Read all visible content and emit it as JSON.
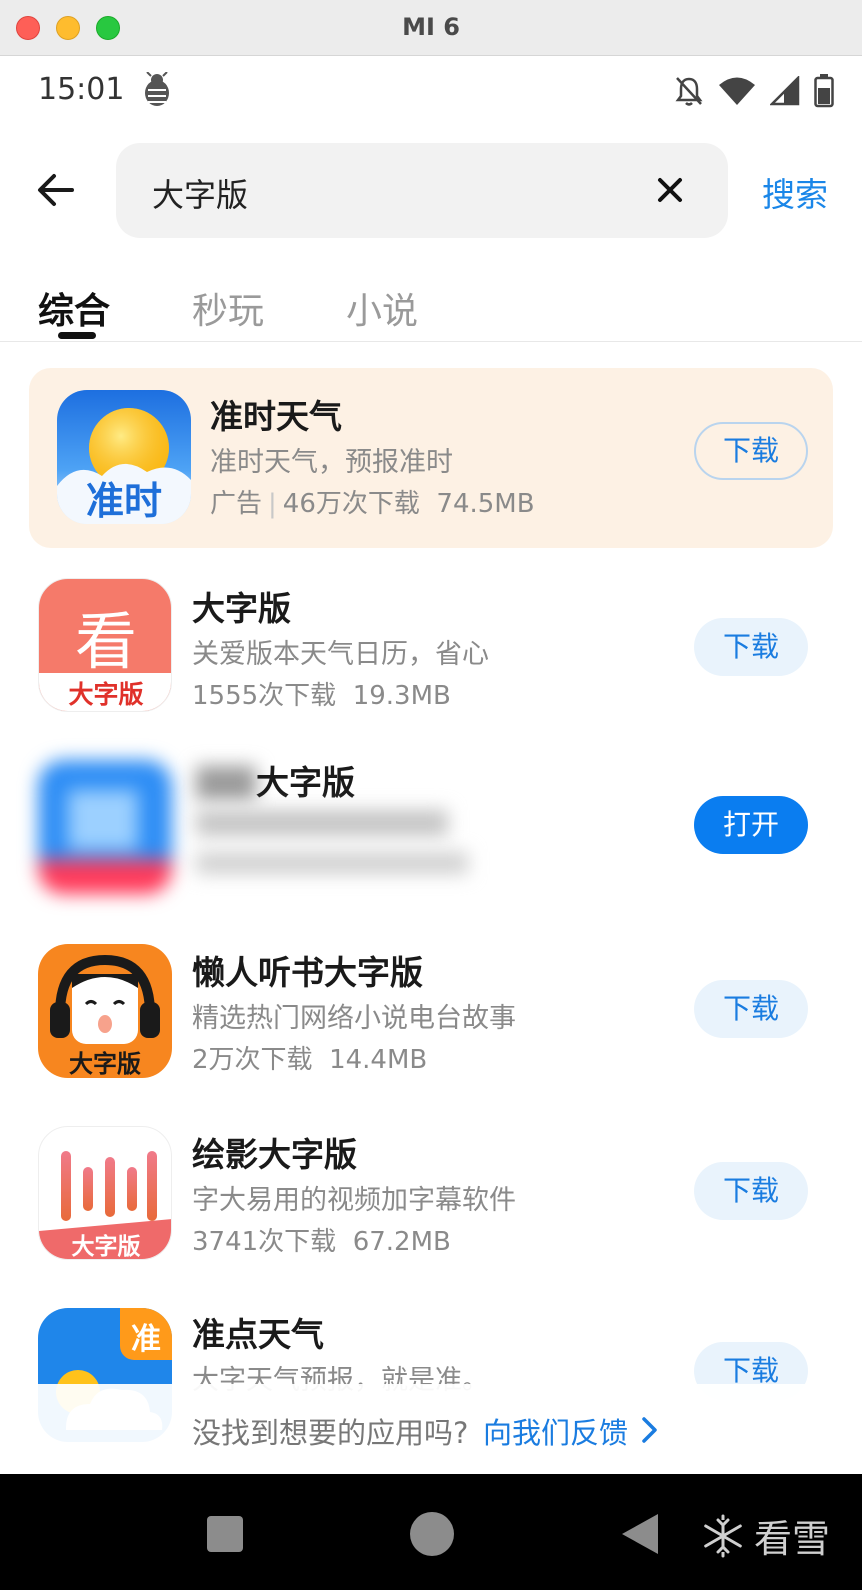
{
  "window": {
    "title": "MI 6"
  },
  "status_bar": {
    "time": "15:01",
    "icons": [
      "bug-icon",
      "bell-off-icon",
      "wifi-icon",
      "signal-icon",
      "battery-icon"
    ]
  },
  "search": {
    "query": "大字版",
    "button_label": "搜索"
  },
  "tabs": [
    {
      "label": "综合",
      "active": true
    },
    {
      "label": "秒玩",
      "active": false
    },
    {
      "label": "小说",
      "active": false
    }
  ],
  "apps": [
    {
      "name": "准时天气",
      "desc": "准时天气，预报准时",
      "ad_label": "广告",
      "downloads": "46万次下载",
      "size": "74.5MB",
      "button": "下载",
      "icon_text": "准时"
    },
    {
      "name": "大字版",
      "desc": "关爱版本天气日历，省心",
      "downloads": "1555次下载",
      "size": "19.3MB",
      "button": "下载",
      "icon_glyph": "看",
      "icon_text": "大字版"
    },
    {
      "name": "大字版",
      "button": "打开"
    },
    {
      "name": "懒人听书大字版",
      "desc": "精选热门网络小说电台故事",
      "downloads": "2万次下载",
      "size": "14.4MB",
      "button": "下载",
      "icon_text": "大字版"
    },
    {
      "name": "绘影大字版",
      "desc": "字大易用的视频加字幕软件",
      "downloads": "3741次下载",
      "size": "67.2MB",
      "button": "下载",
      "icon_text": "大字版"
    },
    {
      "name": "准点天气",
      "desc": "大字天气预报，就是准。",
      "button": "下载",
      "icon_text": "准"
    }
  ],
  "feedback": {
    "text": "没找到想要的应用吗?",
    "link": "向我们反馈"
  },
  "watermark": {
    "text": "看雪"
  },
  "colors": {
    "accent": "#1a7ce0",
    "ad_bg": "#fdf1e4",
    "open_button": "#0a7df0"
  }
}
